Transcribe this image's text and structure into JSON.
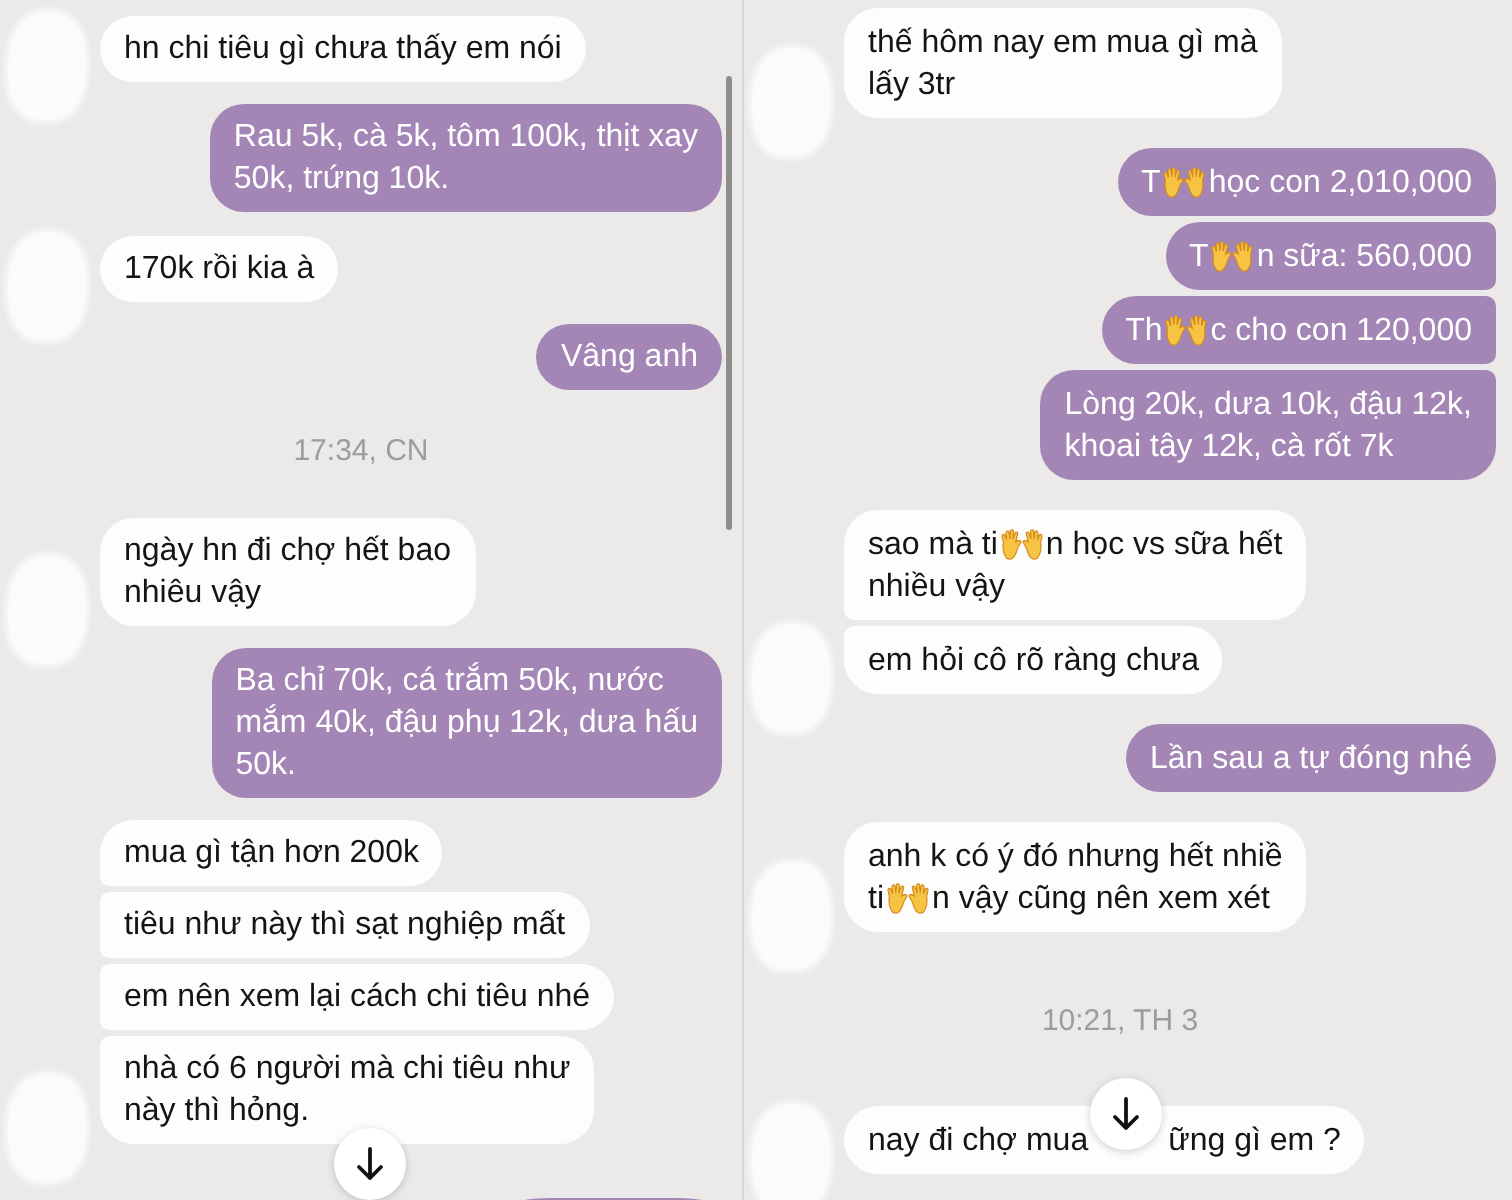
{
  "panels": [
    {
      "scroll_indicator": true,
      "items": [
        {
          "kind": "message",
          "outgoing": false,
          "avatar": true,
          "text": "hn chi tiêu gì chưa thấy em nói"
        },
        {
          "kind": "message",
          "outgoing": true,
          "avatar": false,
          "text": "Rau 5k, cà 5k, tôm 100k, thịt xay\n50k, trứng 10k."
        },
        {
          "kind": "message",
          "outgoing": false,
          "avatar": true,
          "text": "170k rồi kia à"
        },
        {
          "kind": "message",
          "outgoing": true,
          "avatar": false,
          "text": "Vâng anh"
        },
        {
          "kind": "timestamp",
          "text": "17:34, CN"
        },
        {
          "kind": "message",
          "outgoing": false,
          "avatar": true,
          "text": "ngày hn đi chợ hết bao\nnhiêu vậy"
        },
        {
          "kind": "message",
          "outgoing": true,
          "avatar": false,
          "text": "Ba chỉ 70k, cá trắm 50k, nước\nmắm 40k, đậu phụ 12k, dưa hấu\n50k."
        },
        {
          "kind": "message",
          "outgoing": false,
          "avatar": false,
          "text": "mua gì tận hơn 200k"
        },
        {
          "kind": "message",
          "outgoing": false,
          "avatar": false,
          "text": "tiêu như này thì sạt nghiệp mất"
        },
        {
          "kind": "message",
          "outgoing": false,
          "avatar": false,
          "text": "em nên xem lại cách chi tiêu nhé"
        },
        {
          "kind": "message",
          "outgoing": false,
          "avatar": true,
          "text": "nhà có 6 người mà chi tiêu như\nnày thì hỏng."
        },
        {
          "kind": "partial",
          "outgoing": true
        }
      ]
    },
    {
      "scroll_indicator": false,
      "items": [
        {
          "kind": "message",
          "outgoing": false,
          "avatar": true,
          "text": "thế hôm nay em mua gì mà\nlấy 3tr"
        },
        {
          "kind": "message",
          "outgoing": true,
          "avatar": false,
          "parts": [
            {
              "kind": "text",
              "text": "T"
            },
            {
              "kind": "emoji"
            },
            {
              "kind": "text",
              "text": "học con 2,010,000"
            }
          ]
        },
        {
          "kind": "message",
          "outgoing": true,
          "avatar": false,
          "parts": [
            {
              "kind": "text",
              "text": "T"
            },
            {
              "kind": "emoji"
            },
            {
              "kind": "text",
              "text": "n sữa: 560,000"
            }
          ]
        },
        {
          "kind": "message",
          "outgoing": true,
          "avatar": false,
          "parts": [
            {
              "kind": "text",
              "text": "Th"
            },
            {
              "kind": "emoji"
            },
            {
              "kind": "text",
              "text": "c cho con 120,000"
            }
          ]
        },
        {
          "kind": "message",
          "outgoing": true,
          "avatar": false,
          "text": "Lòng 20k, dưa 10k, đậu 12k,\nkhoai tây 12k, cà rốt 7k"
        },
        {
          "kind": "message",
          "outgoing": false,
          "avatar": false,
          "parts": [
            {
              "kind": "text",
              "text": "sao mà ti"
            },
            {
              "kind": "emoji"
            },
            {
              "kind": "text",
              "text": "n học vs sữa hết\nnhiều vậy"
            }
          ]
        },
        {
          "kind": "message",
          "outgoing": false,
          "avatar": true,
          "text": "em hỏi cô rõ ràng chưa"
        },
        {
          "kind": "message",
          "outgoing": true,
          "avatar": false,
          "text": "Lần sau a tự đóng nhé"
        },
        {
          "kind": "message",
          "outgoing": false,
          "avatar": true,
          "parts": [
            {
              "kind": "text",
              "text": "anh k có ý đó nhưng hết nhiề\nti"
            },
            {
              "kind": "emoji"
            },
            {
              "kind": "text",
              "text": "n vậy cũng nên xem xét"
            }
          ]
        },
        {
          "kind": "timestamp",
          "text": "10:21, TH 3"
        },
        {
          "kind": "message",
          "outgoing": false,
          "avatar": true,
          "parts": [
            {
              "kind": "text",
              "text": "nay đi chợ mua"
            },
            {
              "kind": "covered"
            },
            {
              "kind": "text",
              "text": "ững gì em ?"
            }
          ]
        }
      ]
    }
  ]
}
